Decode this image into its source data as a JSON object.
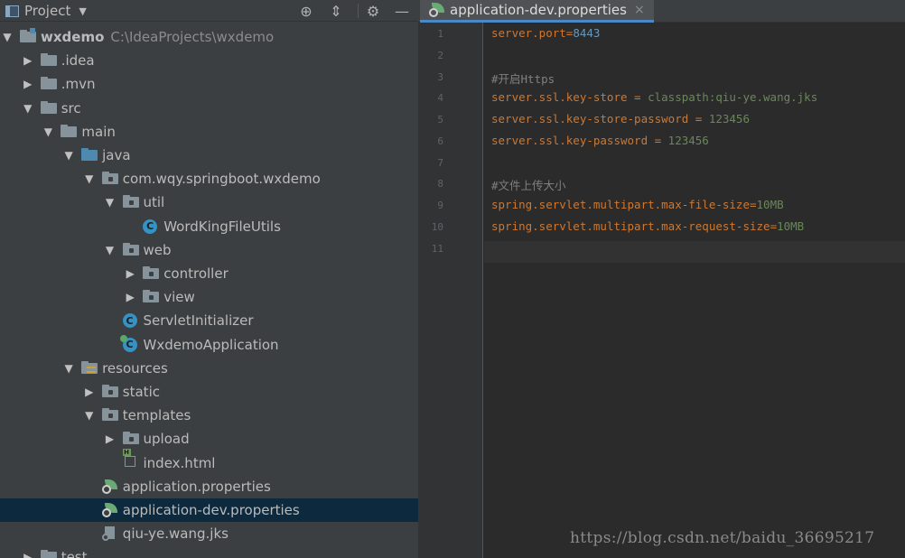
{
  "project_panel": {
    "title": "Project",
    "caret": "▼",
    "buttons": {
      "locate": "⊕",
      "collapse": "⇕",
      "settings": "⚙",
      "hide": "—"
    }
  },
  "tree": [
    {
      "label": "wxdemo",
      "path": "C:\\IdeaProjects\\wxdemo",
      "indent": 0,
      "arrow": "▼",
      "icon": "module-folder",
      "bold": true
    },
    {
      "label": ".idea",
      "indent": 1,
      "arrow": "▶",
      "icon": "folder"
    },
    {
      "label": ".mvn",
      "indent": 1,
      "arrow": "▶",
      "icon": "folder"
    },
    {
      "label": "src",
      "indent": 1,
      "arrow": "▼",
      "icon": "folder"
    },
    {
      "label": "main",
      "indent": 2,
      "arrow": "▼",
      "icon": "folder"
    },
    {
      "label": "java",
      "indent": 3,
      "arrow": "▼",
      "icon": "source-folder"
    },
    {
      "label": "com.wqy.springboot.wxdemo",
      "indent": 4,
      "arrow": "▼",
      "icon": "package"
    },
    {
      "label": "util",
      "indent": 5,
      "arrow": "▼",
      "icon": "package"
    },
    {
      "label": "WordKingFileUtils",
      "indent": 6,
      "arrow": "",
      "icon": "class"
    },
    {
      "label": "web",
      "indent": 5,
      "arrow": "▼",
      "icon": "package"
    },
    {
      "label": "controller",
      "indent": 6,
      "arrow": "▶",
      "icon": "package"
    },
    {
      "label": "view",
      "indent": 6,
      "arrow": "▶",
      "icon": "package"
    },
    {
      "label": "ServletInitializer",
      "indent": 5,
      "arrow": "",
      "icon": "class"
    },
    {
      "label": "WxdemoApplication",
      "indent": 5,
      "arrow": "",
      "icon": "class-run"
    },
    {
      "label": "resources",
      "indent": 3,
      "arrow": "▼",
      "icon": "resources-folder"
    },
    {
      "label": "static",
      "indent": 4,
      "arrow": "▶",
      "icon": "package"
    },
    {
      "label": "templates",
      "indent": 4,
      "arrow": "▼",
      "icon": "package"
    },
    {
      "label": "upload",
      "indent": 5,
      "arrow": "▶",
      "icon": "package"
    },
    {
      "label": "index.html",
      "indent": 5,
      "arrow": "",
      "icon": "html-file"
    },
    {
      "label": "application.properties",
      "indent": 4,
      "arrow": "",
      "icon": "spring-properties"
    },
    {
      "label": "application-dev.properties",
      "indent": 4,
      "arrow": "",
      "icon": "spring-properties",
      "selected": true
    },
    {
      "label": "qiu-ye.wang.jks",
      "indent": 4,
      "arrow": "",
      "icon": "key-file"
    },
    {
      "label": "test",
      "indent": 1,
      "arrow": "▶",
      "icon": "folder"
    }
  ],
  "editor": {
    "tab_label": "application-dev.properties",
    "tab_close": "×",
    "lines": [
      {
        "num": "1",
        "key": "server.port",
        "eq": "=",
        "val": "8443",
        "type": "num"
      },
      {
        "num": "2"
      },
      {
        "num": "3",
        "comment": "#开启Https"
      },
      {
        "num": "4",
        "key": "server.ssl.key-store",
        "eq": " = ",
        "val": "classpath:qiu-ye.wang.jks",
        "type": "str"
      },
      {
        "num": "5",
        "key": "server.ssl.key-store-password",
        "eq": " = ",
        "val": "123456",
        "type": "str"
      },
      {
        "num": "6",
        "key": "server.ssl.key-password",
        "eq": " = ",
        "val": "123456",
        "type": "str"
      },
      {
        "num": "7"
      },
      {
        "num": "8",
        "comment": "#文件上传大小"
      },
      {
        "num": "9",
        "key": "spring.servlet.multipart.max-file-size",
        "eq": "=",
        "val": "10MB",
        "type": "str"
      },
      {
        "num": "10",
        "key": "spring.servlet.multipart.max-request-size",
        "eq": "=",
        "val": "10MB",
        "type": "str"
      },
      {
        "num": "11"
      }
    ]
  },
  "watermark": "https://blog.csdn.net/baidu_36695217"
}
